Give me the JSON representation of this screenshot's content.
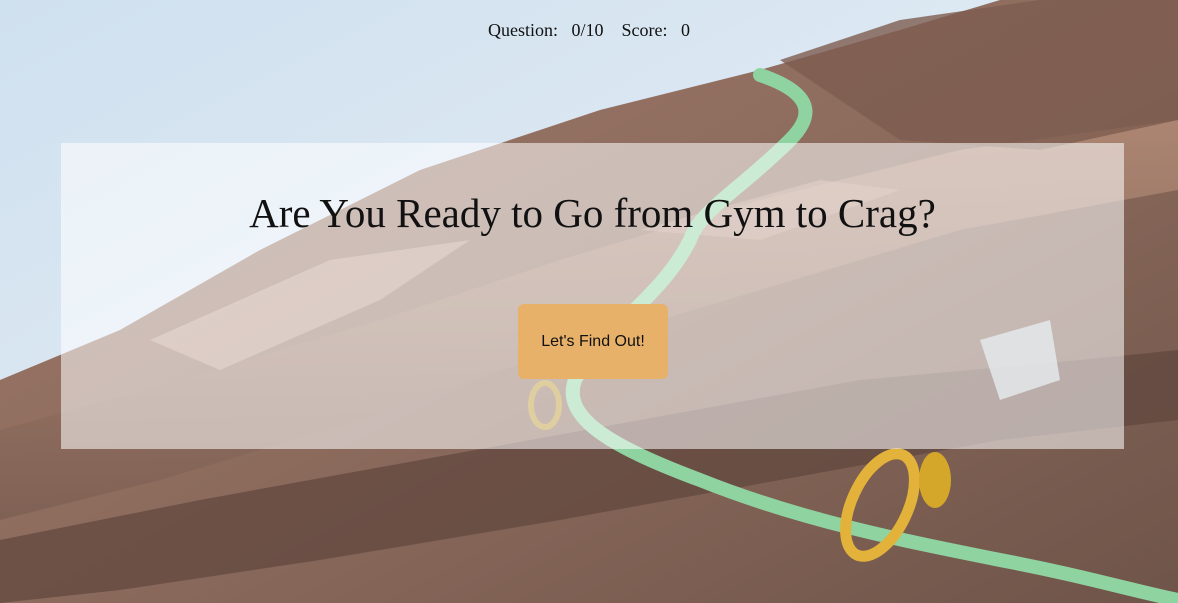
{
  "status": {
    "question_label": "Question:",
    "question_value": "0/10",
    "score_label": "Score:",
    "score_value": "0"
  },
  "hero": {
    "title": "Are You Ready to Go from Gym to Crag?",
    "start_label": "Let's Find Out!"
  },
  "colors": {
    "button_bg": "#e8b16a",
    "panel_bg": "rgba(255,255,255,0.55)",
    "text": "#111111"
  }
}
